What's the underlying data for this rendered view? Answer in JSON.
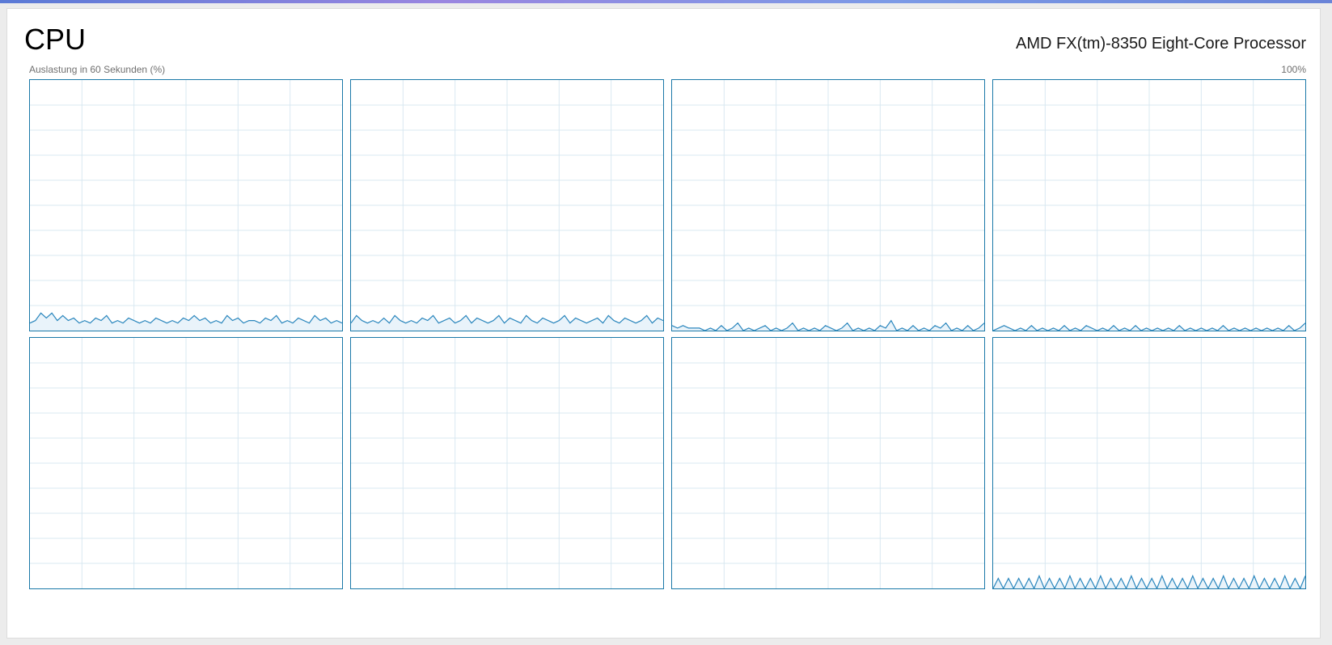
{
  "header": {
    "title": "CPU",
    "processor_name": "AMD FX(tm)-8350 Eight-Core Processor",
    "utilization_caption": "Auslastung in 60 Sekunden (%)",
    "max_label": "100%"
  },
  "colors": {
    "border": "#1a78a8",
    "line": "#2a86bd",
    "fill": "#e9f3fa",
    "grid": "#d9e8f1"
  },
  "chart_data": {
    "type": "area",
    "ylim": [
      0,
      100
    ],
    "grid": true,
    "series": [
      {
        "values": [
          3,
          4,
          7,
          5,
          7,
          4,
          6,
          4,
          5,
          3,
          4,
          3,
          5,
          4,
          6,
          3,
          4,
          3,
          5,
          4,
          3,
          4,
          3,
          5,
          4,
          3,
          4,
          3,
          5,
          4,
          6,
          4,
          5,
          3,
          4,
          3,
          6,
          4,
          5,
          3,
          4,
          4,
          3,
          5,
          4,
          6,
          3,
          4,
          3,
          5,
          4,
          3,
          6,
          4,
          5,
          3,
          4,
          3
        ]
      },
      {
        "values": [
          3,
          6,
          4,
          3,
          4,
          3,
          5,
          3,
          6,
          4,
          3,
          4,
          3,
          5,
          4,
          6,
          3,
          4,
          5,
          3,
          4,
          6,
          3,
          5,
          4,
          3,
          4,
          6,
          3,
          5,
          4,
          3,
          6,
          4,
          3,
          5,
          4,
          3,
          4,
          6,
          3,
          5,
          4,
          3,
          4,
          5,
          3,
          6,
          4,
          3,
          5,
          4,
          3,
          4,
          6,
          3,
          5,
          4
        ]
      },
      {
        "values": [
          2,
          1,
          2,
          1,
          1,
          1,
          0,
          1,
          0,
          2,
          0,
          1,
          3,
          0,
          1,
          0,
          1,
          2,
          0,
          1,
          0,
          1,
          3,
          0,
          1,
          0,
          1,
          0,
          2,
          1,
          0,
          1,
          3,
          0,
          1,
          0,
          1,
          0,
          2,
          1,
          4,
          0,
          1,
          0,
          2,
          0,
          1,
          0,
          2,
          1,
          3,
          0,
          1,
          0,
          2,
          0,
          1,
          3
        ]
      },
      {
        "values": [
          0,
          1,
          2,
          1,
          0,
          1,
          0,
          2,
          0,
          1,
          0,
          1,
          0,
          2,
          0,
          1,
          0,
          2,
          1,
          0,
          1,
          0,
          2,
          0,
          1,
          0,
          2,
          0,
          1,
          0,
          1,
          0,
          1,
          0,
          2,
          0,
          1,
          0,
          1,
          0,
          1,
          0,
          2,
          0,
          1,
          0,
          1,
          0,
          1,
          0,
          1,
          0,
          1,
          0,
          2,
          0,
          1,
          3
        ]
      },
      {
        "values": []
      },
      {
        "values": []
      },
      {
        "values": []
      },
      {
        "values": [
          0,
          4,
          0,
          4,
          0,
          4,
          0,
          4,
          0,
          5,
          0,
          4,
          0,
          4,
          0,
          5,
          0,
          4,
          0,
          4,
          0,
          5,
          0,
          4,
          0,
          4,
          0,
          5,
          0,
          4,
          0,
          4,
          0,
          5,
          0,
          4,
          0,
          4,
          0,
          5,
          0,
          4,
          0,
          4,
          0,
          5,
          0,
          4,
          0,
          4,
          0,
          5,
          0,
          4,
          0,
          4,
          0,
          5,
          0,
          4,
          0,
          5
        ]
      }
    ]
  }
}
